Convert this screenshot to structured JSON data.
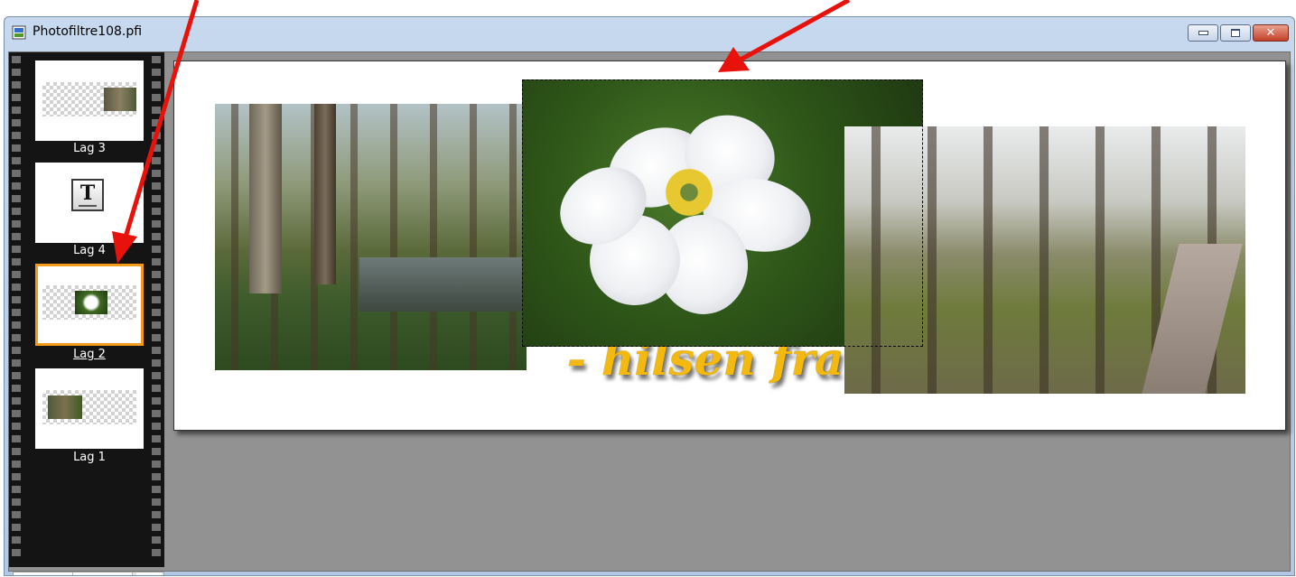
{
  "window": {
    "title": "Photofiltre108.pfi",
    "icon": "document-image-icon"
  },
  "caption_buttons": [
    {
      "name": "minimize",
      "icon": "minimize-icon"
    },
    {
      "name": "restore",
      "icon": "restore-icon"
    },
    {
      "name": "close",
      "icon": "close-icon",
      "glyph": "✕"
    }
  ],
  "layers": [
    {
      "label": "Lag 3",
      "kind": "image",
      "selected": false
    },
    {
      "label": "Lag 4",
      "kind": "text",
      "glyph": "T",
      "selected": false
    },
    {
      "label": "Lag 2",
      "kind": "image",
      "selected": true
    },
    {
      "label": "Lag 1",
      "kind": "image",
      "selected": false
    }
  ],
  "canvas": {
    "caption_text": "- hilsen fra S"
  },
  "scroll": {
    "up": "▲",
    "down": "▼",
    "right": "▶"
  },
  "colors": {
    "selection_border": "#f39a1d",
    "annotation_arrow": "#e8120c",
    "caption_text": "#f3b90f"
  }
}
